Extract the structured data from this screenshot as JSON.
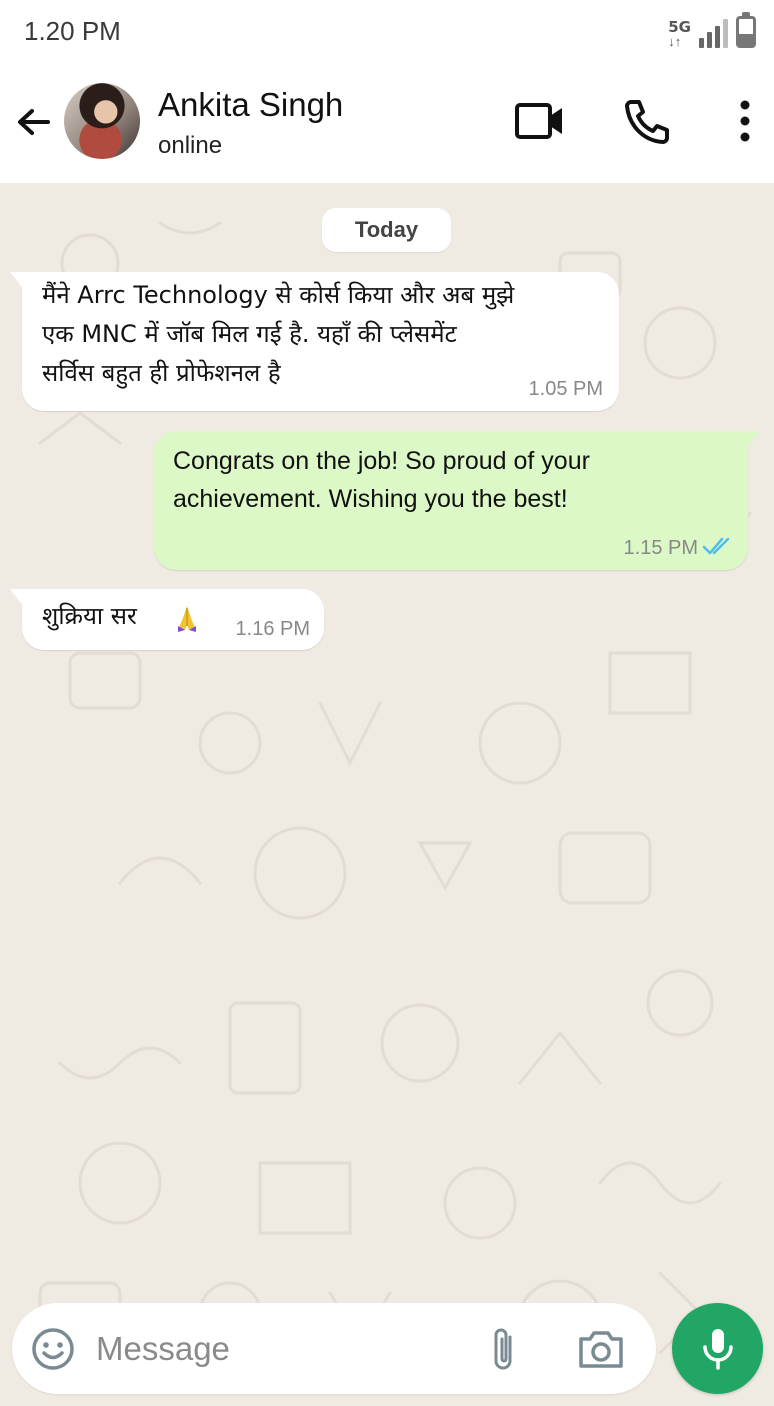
{
  "status_bar": {
    "time": "1.20 PM",
    "network": "5G",
    "network_arrows": "↓↑",
    "signal_icon": "signal-bars-icon",
    "battery_icon": "battery-icon"
  },
  "header": {
    "back_icon": "arrow-left-icon",
    "contact_name": "Ankita Singh",
    "contact_status": "online",
    "video_icon": "video-call-icon",
    "call_icon": "phone-icon",
    "menu_icon": "more-vertical-icon"
  },
  "chat": {
    "date_chip": "Today",
    "messages": [
      {
        "direction": "incoming",
        "lines": [
          "मैंने Arrc Technology से कोर्स किया और अब मुझे",
          "एक MNC में जॉब मिल गई है. यहाँ की प्लेसमेंट",
          "सर्विस बहुत ही प्रोफेशनल है"
        ],
        "time": "1.05 PM"
      },
      {
        "direction": "outgoing",
        "lines": [
          "Congrats on the job! So proud of your",
          "achievement. Wishing you the best!"
        ],
        "time": "1.15 PM",
        "status_icon": "double-check-read-icon"
      },
      {
        "direction": "incoming",
        "text": "शुक्रिया सर",
        "emoji_icon": "folded-hands-icon",
        "time": "1.16 PM"
      }
    ]
  },
  "composer": {
    "placeholder": "Message",
    "emoji_icon": "smiley-icon",
    "attach_icon": "paperclip-icon",
    "camera_icon": "camera-icon",
    "mic_icon": "microphone-icon"
  },
  "colors": {
    "chat_background": "#efeae2",
    "outgoing_bubble": "#dcf8c6",
    "incoming_bubble": "#ffffff",
    "accent_green": "#21a665",
    "read_ticks": "#53bdeb"
  }
}
